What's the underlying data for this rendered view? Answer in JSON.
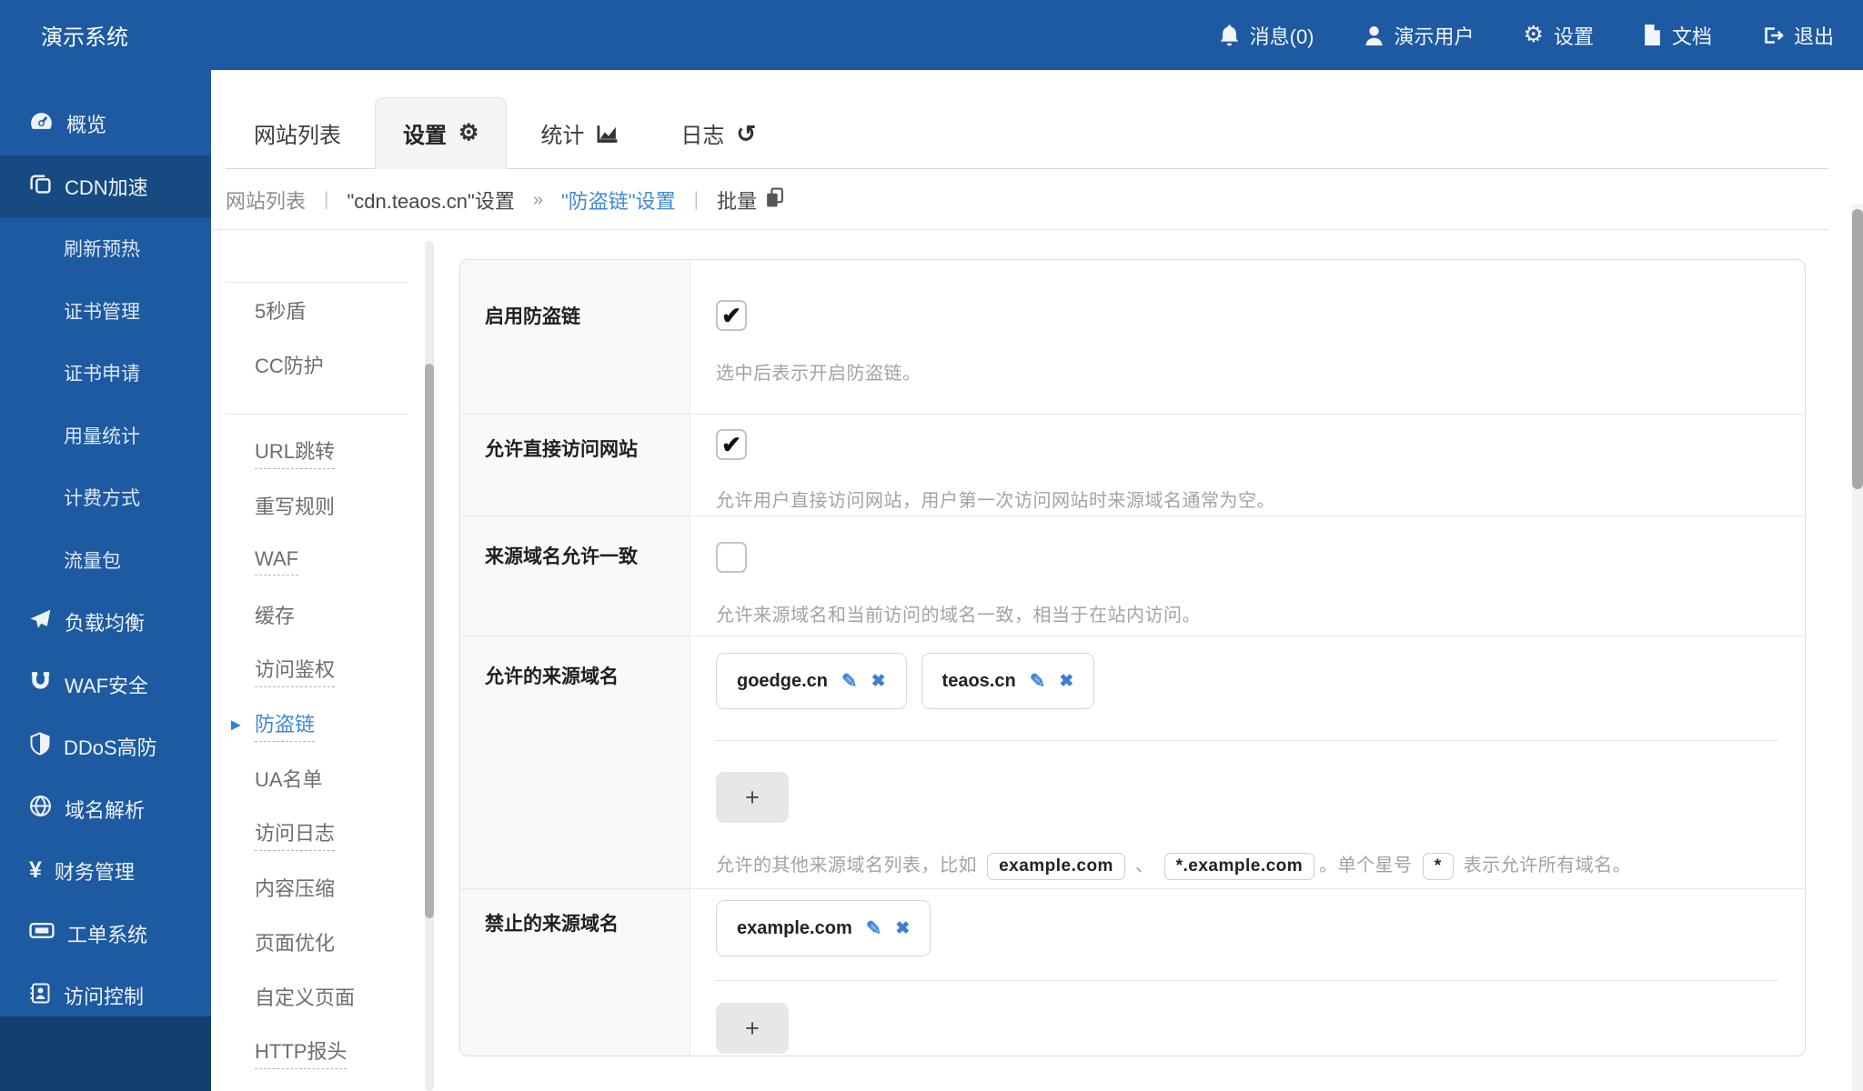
{
  "colors": {
    "bar_blue": "#1e5aa2",
    "active_blue": "#164a80",
    "footer_blue": "#123f70",
    "link_blue": "#4089d9",
    "label_bg": "#f9f9f9"
  },
  "topbar": {
    "brand": "演示系统",
    "items": [
      {
        "name": "messages",
        "icon": "bell-icon",
        "label": "消息(0)"
      },
      {
        "name": "current-user",
        "icon": "user-icon",
        "label": "演示用户"
      },
      {
        "name": "settings",
        "icon": "gear-icon",
        "label": "设置"
      },
      {
        "name": "docs",
        "icon": "document-icon",
        "label": "文档"
      },
      {
        "name": "logout",
        "icon": "logout-icon",
        "label": "退出"
      }
    ]
  },
  "sidebar": {
    "items": [
      {
        "name": "overview",
        "icon": "gauge-icon",
        "label": "概览"
      },
      {
        "name": "cdn-acceleration",
        "icon": "cdn-icon",
        "label": "CDN加速",
        "active": true
      },
      {
        "name": "refresh-preheat",
        "label": "刷新预热",
        "sub": true
      },
      {
        "name": "cert-management",
        "label": "证书管理",
        "sub": true
      },
      {
        "name": "cert-apply",
        "label": "证书申请",
        "sub": true
      },
      {
        "name": "usage-stats",
        "label": "用量统计",
        "sub": true
      },
      {
        "name": "billing-method",
        "label": "计费方式",
        "sub": true
      },
      {
        "name": "traffic-package",
        "label": "流量包",
        "sub": true
      },
      {
        "name": "load-balancer",
        "icon": "paper-plane-icon",
        "label": "负载均衡"
      },
      {
        "name": "waf-security",
        "icon": "magnet-icon",
        "label": "WAF安全"
      },
      {
        "name": "ddos-protection",
        "icon": "shield-icon",
        "label": "DDoS高防"
      },
      {
        "name": "dns-resolution",
        "icon": "globe-icon",
        "label": "域名解析"
      },
      {
        "name": "finance-management",
        "icon": "yen-icon",
        "label": "财务管理"
      },
      {
        "name": "ticket-system",
        "icon": "ticket-icon",
        "label": "工单系统"
      },
      {
        "name": "access-control",
        "icon": "contact-card-icon",
        "label": "访问控制"
      }
    ]
  },
  "tabs": [
    {
      "name": "site-list",
      "label": "网站列表"
    },
    {
      "name": "settings",
      "label": "设置",
      "icon": "gear-icon",
      "active": true
    },
    {
      "name": "stats",
      "label": "统计",
      "icon": "chart-icon"
    },
    {
      "name": "logs",
      "label": "日志",
      "icon": "history-icon"
    }
  ],
  "breadcrumb": {
    "site_list": "网站列表",
    "site_settings": "\"cdn.teaos.cn\"设置",
    "current": "\"防盗链\"设置",
    "batch": "批量",
    "sep_bar": "|",
    "sep_arrow": "»"
  },
  "submenu": {
    "items": [
      {
        "name": "5s-shield",
        "label": "5秒盾"
      },
      {
        "name": "cc-protection",
        "label": "CC防护"
      },
      {
        "name": "url-redirect",
        "label": "URL跳转",
        "dashed": true,
        "group2": true
      },
      {
        "name": "rewrite-rules",
        "label": "重写规则"
      },
      {
        "name": "waf",
        "label": "WAF",
        "dashed": true
      },
      {
        "name": "cache",
        "label": "缓存"
      },
      {
        "name": "access-auth",
        "label": "访问鉴权",
        "dashed": true
      },
      {
        "name": "hotlink-protection",
        "label": "防盗链",
        "dashed": true,
        "active": true
      },
      {
        "name": "ua-list",
        "label": "UA名单"
      },
      {
        "name": "access-log",
        "label": "访问日志",
        "dashed": true
      },
      {
        "name": "content-compression",
        "label": "内容压缩"
      },
      {
        "name": "page-optimization",
        "label": "页面优化"
      },
      {
        "name": "custom-pages",
        "label": "自定义页面"
      },
      {
        "name": "http-headers",
        "label": "HTTP报头",
        "dashed": true
      }
    ]
  },
  "ui": {
    "check_glyph": "✔",
    "edit_glyph": "✎",
    "remove_glyph": "✖",
    "add_label": "+",
    "active_arrow": "▶"
  },
  "form": {
    "rows": [
      {
        "type": "checkbox",
        "name": "enable-hotlink-protection",
        "label": "启用防盗链",
        "checked": true,
        "desc": "选中后表示开启防盗链。"
      },
      {
        "type": "checkbox",
        "name": "allow-direct-access",
        "label": "允许直接访问网站",
        "checked": true,
        "desc": "允许用户直接访问网站，用户第一次访问网站时来源域名通常为空。"
      },
      {
        "type": "checkbox",
        "name": "allow-same-origin",
        "label": "来源域名允许一致",
        "checked": false,
        "desc": "允许来源域名和当前访问的域名一致，相当于在站内访问。"
      },
      {
        "type": "tags",
        "name": "allowed-origin-domains",
        "label": "允许的来源域名",
        "tags": [
          "goedge.cn",
          "teaos.cn"
        ],
        "desc_segments": [
          {
            "t": "text",
            "v": "允许的其他来源域名列表，比如 "
          },
          {
            "t": "chip",
            "v": "example.com"
          },
          {
            "t": "text",
            "v": " 、 "
          },
          {
            "t": "chip",
            "v": "*.example.com"
          },
          {
            "t": "text",
            "v": "。单个星号 "
          },
          {
            "t": "chip",
            "v": "*"
          },
          {
            "t": "text",
            "v": " 表示允许所有域名。"
          }
        ]
      },
      {
        "type": "tags",
        "name": "forbidden-origin-domains",
        "label": "禁止的来源域名",
        "tags": [
          "example.com"
        ]
      }
    ]
  }
}
